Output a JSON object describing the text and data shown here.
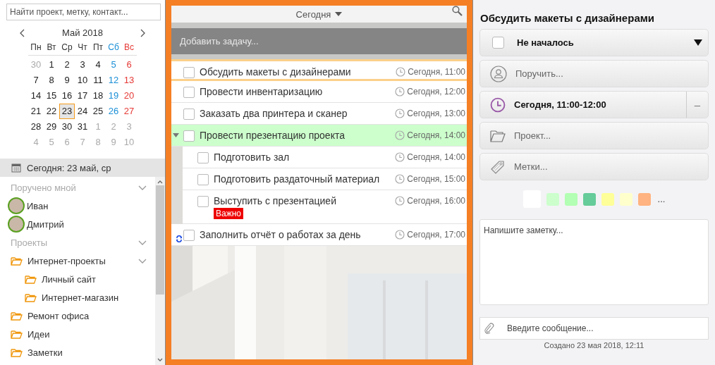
{
  "search": {
    "placeholder": "Найти проект, метку, контакт..."
  },
  "calendar": {
    "title": "Май 2018",
    "weekdays": [
      "Пн",
      "Вт",
      "Ср",
      "Чт",
      "Пт",
      "Сб",
      "Вс"
    ],
    "weeks": [
      [
        {
          "d": "30",
          "muted": true,
          "selected": false
        },
        {
          "d": "1",
          "muted": false,
          "selected": false
        },
        {
          "d": "2",
          "muted": false,
          "selected": false
        },
        {
          "d": "3",
          "muted": false,
          "selected": false
        },
        {
          "d": "4",
          "muted": false,
          "selected": false
        },
        {
          "d": "5",
          "muted": false,
          "selected": false
        },
        {
          "d": "6",
          "muted": false,
          "selected": false
        }
      ],
      [
        {
          "d": "7",
          "muted": false,
          "selected": false
        },
        {
          "d": "8",
          "muted": false,
          "selected": false
        },
        {
          "d": "9",
          "muted": false,
          "selected": false
        },
        {
          "d": "10",
          "muted": false,
          "selected": false
        },
        {
          "d": "11",
          "muted": false,
          "selected": false
        },
        {
          "d": "12",
          "muted": false,
          "selected": false
        },
        {
          "d": "13",
          "muted": false,
          "selected": false
        }
      ],
      [
        {
          "d": "14",
          "muted": false,
          "selected": false
        },
        {
          "d": "15",
          "muted": false,
          "selected": false
        },
        {
          "d": "16",
          "muted": false,
          "selected": false
        },
        {
          "d": "17",
          "muted": false,
          "selected": false
        },
        {
          "d": "18",
          "muted": false,
          "selected": false
        },
        {
          "d": "19",
          "muted": false,
          "selected": false
        },
        {
          "d": "20",
          "muted": false,
          "selected": false
        }
      ],
      [
        {
          "d": "21",
          "muted": false,
          "selected": false
        },
        {
          "d": "22",
          "muted": false,
          "selected": false
        },
        {
          "d": "23",
          "muted": false,
          "selected": true
        },
        {
          "d": "24",
          "muted": false,
          "selected": false
        },
        {
          "d": "25",
          "muted": false,
          "selected": false
        },
        {
          "d": "26",
          "muted": false,
          "selected": false
        },
        {
          "d": "27",
          "muted": false,
          "selected": false
        }
      ],
      [
        {
          "d": "28",
          "muted": false,
          "selected": false
        },
        {
          "d": "29",
          "muted": false,
          "selected": false
        },
        {
          "d": "30",
          "muted": false,
          "selected": false
        },
        {
          "d": "31",
          "muted": false,
          "selected": false
        },
        {
          "d": "1",
          "muted": true,
          "selected": false
        },
        {
          "d": "2",
          "muted": true,
          "selected": false
        },
        {
          "d": "3",
          "muted": true,
          "selected": false
        }
      ],
      [
        {
          "d": "4",
          "muted": true,
          "selected": false
        },
        {
          "d": "5",
          "muted": true,
          "selected": false
        },
        {
          "d": "6",
          "muted": true,
          "selected": false
        },
        {
          "d": "7",
          "muted": true,
          "selected": false
        },
        {
          "d": "8",
          "muted": true,
          "selected": false
        },
        {
          "d": "9",
          "muted": true,
          "selected": false
        },
        {
          "d": "10",
          "muted": true,
          "selected": false
        }
      ]
    ]
  },
  "today": {
    "label": "Сегодня: 23 май, ср",
    "selected": true
  },
  "sidebar": [
    {
      "kind": "section",
      "label": "Поручено мной",
      "expanded": true,
      "children": [
        {
          "kind": "person",
          "label": "Иван"
        },
        {
          "kind": "person",
          "label": "Дмитрий"
        }
      ]
    },
    {
      "kind": "section",
      "label": "Проекты",
      "expanded": true,
      "children": [
        {
          "kind": "folder",
          "label": "Интернет-проекты",
          "expanded": true,
          "children": [
            {
              "kind": "folder",
              "label": "Личный сайт"
            },
            {
              "kind": "folder",
              "label": "Интернет-магазин"
            }
          ]
        },
        {
          "kind": "folder",
          "label": "Ремонт офиса"
        },
        {
          "kind": "folder",
          "label": "Идеи"
        },
        {
          "kind": "folder",
          "label": "Заметки"
        }
      ]
    }
  ],
  "list_header": {
    "title": "Сегодня"
  },
  "add_task": {
    "placeholder": "Добавить задачу..."
  },
  "tasks": [
    {
      "title": "Обсудить макеты с дизайнерами",
      "time": "Сегодня, 11:00",
      "checked": false,
      "selected": true,
      "recurring": false
    },
    {
      "title": "Провести инвентаризацию",
      "time": "Сегодня, 12:00",
      "checked": false,
      "selected": false,
      "recurring": false
    },
    {
      "title": "Заказать два принтера и сканер",
      "time": "Сегодня, 13:00",
      "checked": false,
      "selected": false,
      "recurring": false
    },
    {
      "title": "Провести презентацию проекта",
      "time": "Сегодня, 14:00",
      "checked": false,
      "selected": false,
      "recurring": false,
      "color": "#ccffcc",
      "expanded": true,
      "children": [
        {
          "title": "Подготовить зал",
          "time": "Сегодня, 14:00",
          "checked": false,
          "selected": false,
          "recurring": false
        },
        {
          "title": "Подготовить раздаточный материал",
          "time": "Сегодня, 15:00",
          "checked": false,
          "selected": false,
          "recurring": false
        },
        {
          "title": "Выступить с презентацией",
          "time": "Сегодня, 16:00",
          "checked": false,
          "selected": false,
          "recurring": false,
          "tag": "Важно"
        }
      ]
    },
    {
      "title": "Заполнить отчёт о работах за день",
      "time": "Сегодня, 17:00",
      "checked": false,
      "selected": false,
      "recurring": true
    }
  ],
  "details": {
    "title": "Обсудить макеты с дизайнерами",
    "status": {
      "label": "Не началось",
      "checked": false
    },
    "fields": [
      {
        "kind": "assign",
        "placeholder": "Поручить..."
      },
      {
        "kind": "date",
        "value": "Сегодня, 11:00-12:00",
        "action": "–"
      },
      {
        "kind": "project",
        "placeholder": "Проект..."
      },
      {
        "kind": "tags",
        "placeholder": "Метки..."
      }
    ],
    "colors": [
      {
        "color": "#ffffff",
        "selected": true
      },
      {
        "color": "#ccffcc",
        "selected": false
      },
      {
        "color": "#b3ffb3",
        "selected": false
      },
      {
        "color": "#66cc99",
        "selected": false
      },
      {
        "color": "#ffff99",
        "selected": false
      },
      {
        "color": "#ffffcc",
        "selected": false
      },
      {
        "color": "#ffb380",
        "selected": false
      }
    ],
    "more_colors": "...",
    "note": {
      "placeholder": "Напишите заметку..."
    },
    "message": {
      "placeholder": "Введите сообщение..."
    },
    "created": "Создано 23 мая 2018, 12:11"
  }
}
